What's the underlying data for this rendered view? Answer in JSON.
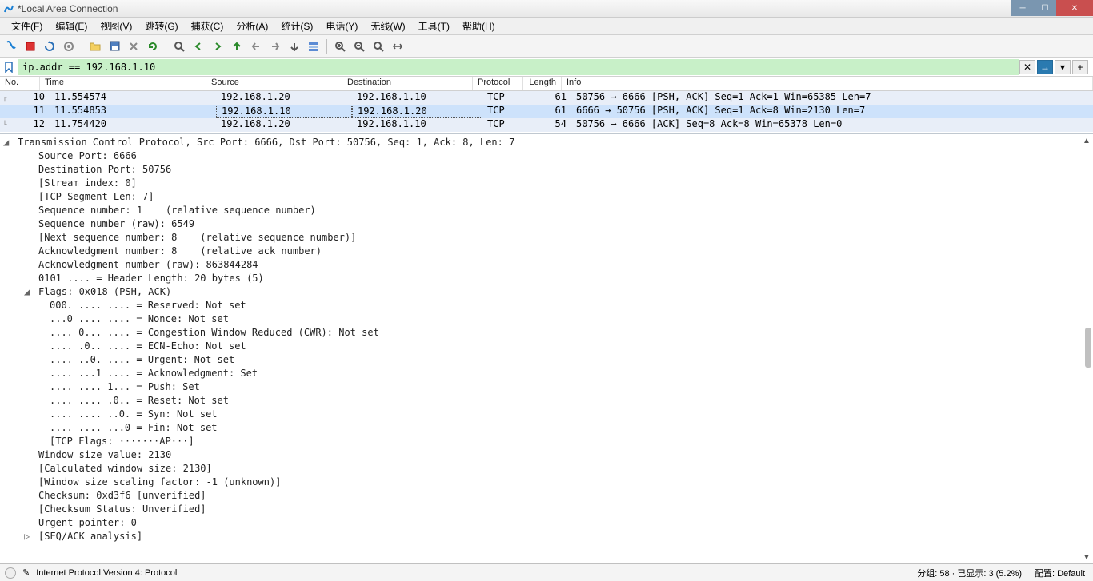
{
  "window": {
    "title": "*Local Area Connection"
  },
  "menu": {
    "file": "文件(F)",
    "edit": "编辑(E)",
    "view": "视图(V)",
    "go": "跳转(G)",
    "capture": "捕获(C)",
    "analyze": "分析(A)",
    "statistics": "统计(S)",
    "telephony": "电话(Y)",
    "wireless": "无线(W)",
    "tools": "工具(T)",
    "help": "帮助(H)"
  },
  "filter": {
    "value": "ip.addr == 192.168.1.10"
  },
  "columns": {
    "no": "No.",
    "time": "Time",
    "source": "Source",
    "destination": "Destination",
    "protocol": "Protocol",
    "length": "Length",
    "info": "Info"
  },
  "packets": [
    {
      "no": "10",
      "time": "11.554574",
      "src": "192.168.1.20",
      "dst": "192.168.1.10",
      "proto": "TCP",
      "len": "61",
      "info": "50756 → 6666 [PSH, ACK] Seq=1 Ack=1 Win=65385 Len=7"
    },
    {
      "no": "11",
      "time": "11.554853",
      "src": "192.168.1.10",
      "dst": "192.168.1.20",
      "proto": "TCP",
      "len": "61",
      "info": "6666 → 50756 [PSH, ACK] Seq=1 Ack=8 Win=2130 Len=7"
    },
    {
      "no": "12",
      "time": "11.754420",
      "src": "192.168.1.20",
      "dst": "192.168.1.10",
      "proto": "TCP",
      "len": "54",
      "info": "50756 → 6666 [ACK] Seq=8 Ack=8 Win=65378 Len=0"
    }
  ],
  "details": {
    "header": "Transmission Control Protocol, Src Port: 6666, Dst Port: 50756, Seq: 1, Ack: 8, Len: 7",
    "srcport": "Source Port: 6666",
    "dstport": "Destination Port: 50756",
    "stream": "[Stream index: 0]",
    "seglen": "[TCP Segment Len: 7]",
    "seqnum": "Sequence number: 1    (relative sequence number)",
    "seqraw": "Sequence number (raw): 6549",
    "nextseq": "[Next sequence number: 8    (relative sequence number)]",
    "acknum": "Acknowledgment number: 8    (relative ack number)",
    "ackraw": "Acknowledgment number (raw): 863844284",
    "hdrlen": "0101 .... = Header Length: 20 bytes (5)",
    "flags": "Flags: 0x018 (PSH, ACK)",
    "f_res": "000. .... .... = Reserved: Not set",
    "f_non": "...0 .... .... = Nonce: Not set",
    "f_cwr": ".... 0... .... = Congestion Window Reduced (CWR): Not set",
    "f_ecn": ".... .0.. .... = ECN-Echo: Not set",
    "f_urg": ".... ..0. .... = Urgent: Not set",
    "f_ack": ".... ...1 .... = Acknowledgment: Set",
    "f_psh": ".... .... 1... = Push: Set",
    "f_rst": ".... .... .0.. = Reset: Not set",
    "f_syn": ".... .... ..0. = Syn: Not set",
    "f_fin": ".... .... ...0 = Fin: Not set",
    "f_str": "[TCP Flags: ·······AP···]",
    "winsize": "Window size value: 2130",
    "calcwin": "[Calculated window size: 2130]",
    "winscale": "[Window size scaling factor: -1 (unknown)]",
    "checksum": "Checksum: 0xd3f6 [unverified]",
    "chkstat": "[Checksum Status: Unverified]",
    "urgptr": "Urgent pointer: 0",
    "seqack": "[SEQ/ACK analysis]"
  },
  "status": {
    "left": "Internet Protocol Version 4: Protocol",
    "pkts": "分组: 58 · 已显示: 3 (5.2%)",
    "profile": "配置: Default"
  }
}
